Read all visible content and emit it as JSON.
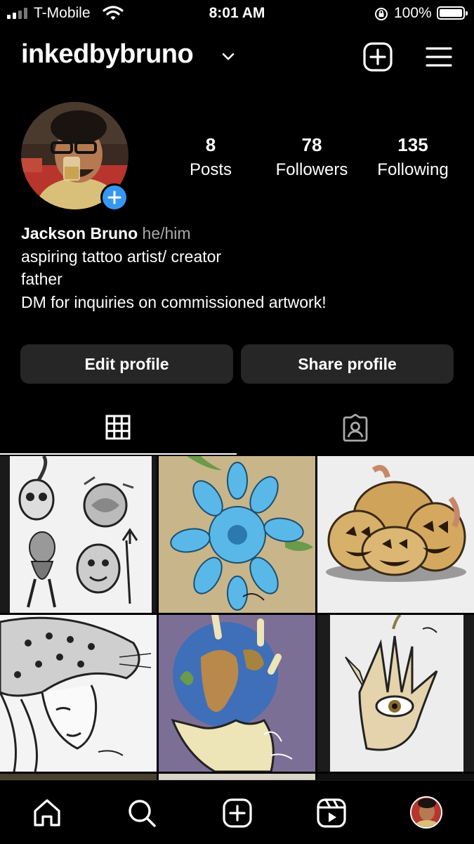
{
  "status_bar": {
    "carrier": "T-Mobile",
    "time": "8:01 AM",
    "battery_percent": "100%"
  },
  "header": {
    "username": "inkedbybruno"
  },
  "profile": {
    "stats": [
      {
        "value": "8",
        "label": "Posts"
      },
      {
        "value": "78",
        "label": "Followers"
      },
      {
        "value": "135",
        "label": "Following"
      }
    ],
    "name": "Jackson Bruno",
    "pronouns": "he/him",
    "bio_lines": [
      "aspiring tattoo artist/ creator",
      "father",
      "DM for inquiries on commissioned artwork!"
    ]
  },
  "buttons": {
    "edit_profile": "Edit profile",
    "share_profile": "Share profile"
  },
  "tabs": [
    {
      "icon": "grid-icon",
      "active": true
    },
    {
      "icon": "tagged-icon",
      "active": false
    }
  ],
  "posts": [
    {
      "subject": "flash-sheet"
    },
    {
      "subject": "blue-chrysanthemum"
    },
    {
      "subject": "pumpkins"
    },
    {
      "subject": "leopard-woman"
    },
    {
      "subject": "hand-holding-earth"
    },
    {
      "subject": "eye-hand"
    }
  ],
  "nav": [
    {
      "icon": "home-icon"
    },
    {
      "icon": "search-icon"
    },
    {
      "icon": "create-icon"
    },
    {
      "icon": "reels-icon"
    },
    {
      "icon": "profile-avatar"
    }
  ],
  "colors": {
    "background": "#000000",
    "button_bg": "#262626",
    "accent_blue": "#3797f0",
    "secondary_text": "#a8a8a8"
  }
}
